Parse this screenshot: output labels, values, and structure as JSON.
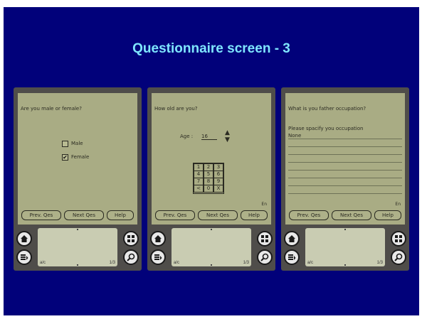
{
  "slide": {
    "title": "Questionnaire screen - 3"
  },
  "screens": [
    {
      "question": "Are you male or female?",
      "options": [
        {
          "label": "Male",
          "checked": false
        },
        {
          "label": "Female",
          "checked": true
        }
      ],
      "buttons": {
        "prev": "Prev. Qes",
        "next": "Next Qes",
        "help": "Help"
      }
    },
    {
      "question": "How old are you?",
      "age_label": "Age :",
      "age_value": "16",
      "keypad": [
        "1",
        "2",
        "3",
        "4",
        "5",
        "6",
        "7",
        "8",
        "9",
        "<",
        "0",
        "X"
      ],
      "lang_indicator": "En",
      "buttons": {
        "prev": "Prev. Qes",
        "next": "Next Qes",
        "help": "Help"
      }
    },
    {
      "question": "What is you father occupation?",
      "prompt": "Please spacify you occupation",
      "input_value": "None",
      "lang_indicator": "En",
      "buttons": {
        "prev": "Prev. Qes",
        "next": "Next Qes",
        "help": "Help"
      }
    }
  ],
  "graffiti": {
    "left_mark": "a/c",
    "right_mark": "1/3"
  },
  "colors": {
    "slide_bg": "#01017a",
    "title": "#7fe6ff",
    "lcd": "#a9ac84"
  },
  "icons": [
    "home-icon",
    "menu-icon",
    "apps-icon",
    "find-icon"
  ]
}
